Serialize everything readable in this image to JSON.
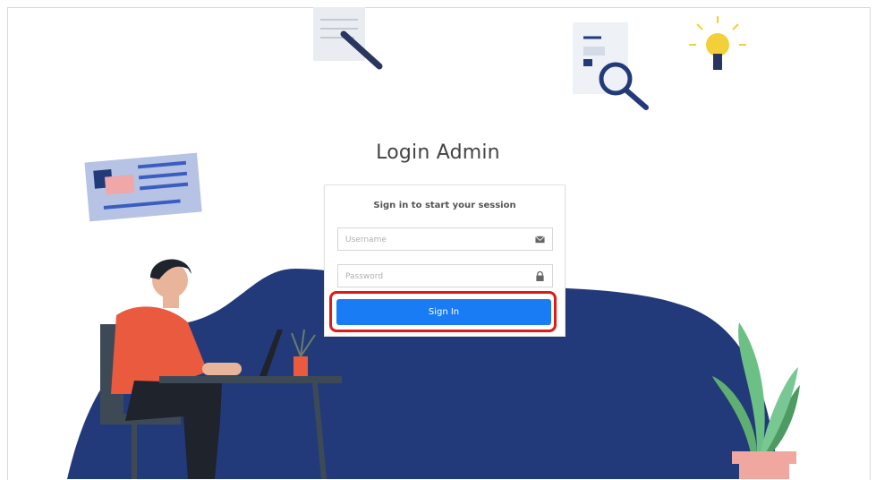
{
  "page": {
    "title": "Login Admin"
  },
  "card": {
    "message": "Sign in to start your session",
    "username_placeholder": "Username",
    "password_placeholder": "Password",
    "submit_label": "Sign In"
  },
  "colors": {
    "primary": "#1a7cf5",
    "highlight": "#e01a1a",
    "blob": "#223a7a"
  },
  "icons": {
    "username": "envelope-icon",
    "password": "lock-icon"
  }
}
